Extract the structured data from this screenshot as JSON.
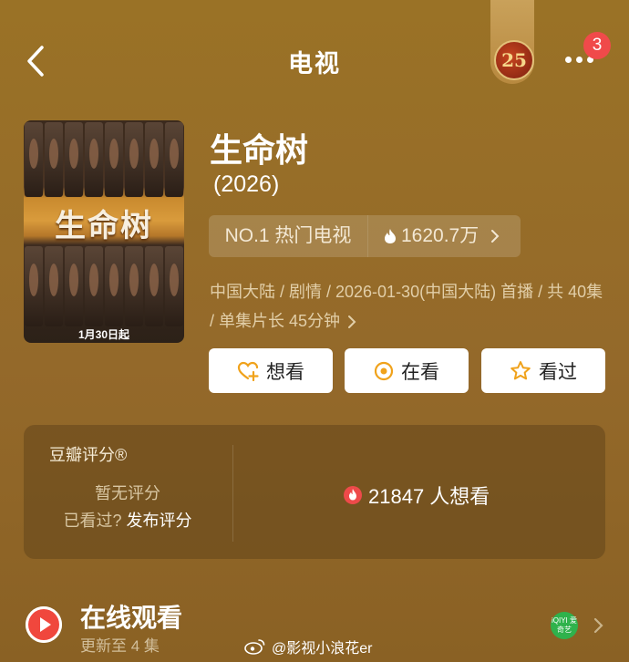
{
  "header": {
    "title": "电视",
    "badge_text": "25",
    "notification_count": "3"
  },
  "poster": {
    "title": "生命树",
    "release_date": "1月30日起"
  },
  "movie": {
    "name": "生命树",
    "year": "(2026)",
    "rank_label": "NO.1 热门电视",
    "heat": "1620.7万",
    "meta": "中国大陆 / 剧情 / 2026-01-30(中国大陆) 首播 / 共 40集 / 单集片长 45分钟"
  },
  "actions": {
    "want": "想看",
    "watching": "在看",
    "watched": "看过"
  },
  "rating": {
    "title": "豆瓣评分®",
    "no_rating": "暂无评分",
    "seen_prefix": "已看过?",
    "rate_link": "发布评分",
    "want_count": "21847 人想看"
  },
  "online": {
    "title": "在线观看",
    "update": "更新至 4 集",
    "platform": "iQIYI 爱奇艺"
  },
  "watermark": {
    "text": "@影视小浪花er"
  },
  "colors": {
    "accent": "#f04a4a",
    "background": "#94692a",
    "button_icon": "#f0a21b"
  }
}
